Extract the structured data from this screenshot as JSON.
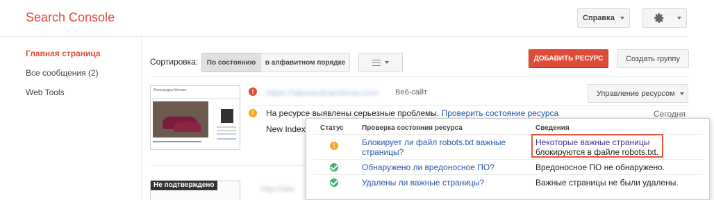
{
  "header": {
    "brand": "Search Console",
    "help_label": "Справка",
    "settings_icon": "gear-icon"
  },
  "sidebar": {
    "items": [
      {
        "label": "Главная страница",
        "active": true
      },
      {
        "label": "Все сообщения (2)",
        "active": false
      },
      {
        "label": "Web Tools",
        "active": false
      }
    ]
  },
  "toolbar": {
    "sort_label": "Сортировка:",
    "sort_options": [
      "По состоянию",
      "в алфавитном порядке"
    ],
    "selected_sort": "По состоянию",
    "view_icon": "list-view-icon",
    "add_resource": "ДОБАВИТЬ РЕСУРС",
    "create_group": "Создать группу"
  },
  "site": {
    "url": "https://alexandramilova.com",
    "type": "Веб-сайт",
    "manage_label": "Управление ресурсом",
    "issue_text": "На ресурсе выявлены серьезные проблемы.",
    "issue_link": "Проверить состояние ресурса",
    "issue_date": "Сегодня",
    "new_index": "New Index",
    "thumb_title": "Александра Милова",
    "status_colors": {
      "error": "#dd4b39",
      "warning": "#f4a81f",
      "ok": "#3cb371"
    }
  },
  "site2": {
    "badge": "Не подтверждено",
    "url": "http://site"
  },
  "health_popup": {
    "headers": [
      "Статус",
      "Проверка состояния ресурса",
      "Сведения"
    ],
    "rows": [
      {
        "status": "warning",
        "check": "Блокирует ли файл robots.txt важные страницы?",
        "check_line1": "Блокирует ли файл robots.txt важные",
        "check_line2": "страницы?",
        "details_line1": "Некоторые важные страницы",
        "details_line2": "блокируются в файле robots.txt."
      },
      {
        "status": "ok",
        "check": "Обнаружено ли вредоносное ПО?",
        "details": "Вредоносное ПО не обнаружено."
      },
      {
        "status": "ok",
        "check": "Удалены ли важные страницы?",
        "details": "Важные страницы не были удалены."
      }
    ]
  }
}
